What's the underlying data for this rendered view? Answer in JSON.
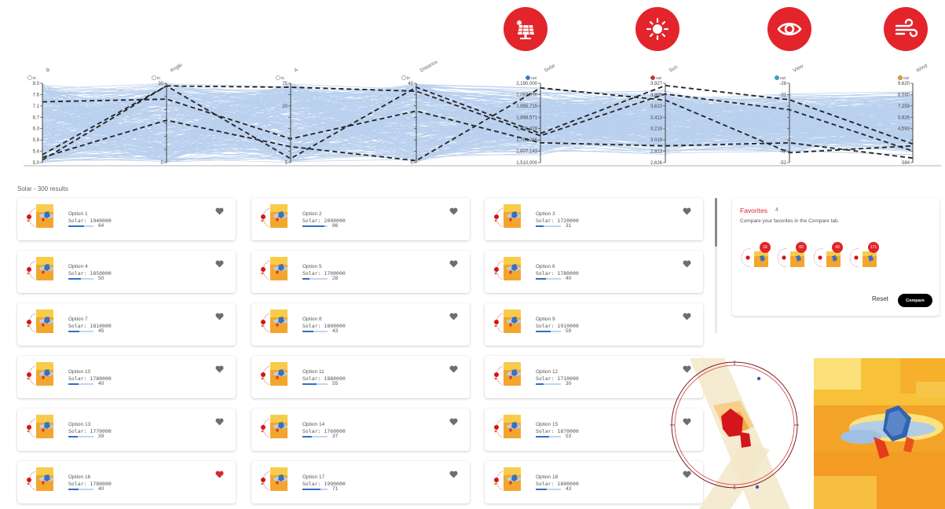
{
  "objectives": [
    {
      "name": "solar-icon",
      "color": "#e3242b"
    },
    {
      "name": "sun-icon",
      "color": "#e3242b"
    },
    {
      "name": "eye-icon",
      "color": "#e3242b"
    },
    {
      "name": "wind-icon",
      "color": "#e3242b"
    }
  ],
  "chart_data": {
    "type": "parallel-coordinates",
    "line_color": "#3a7ccf",
    "highlight_color": "#222222",
    "axes": [
      {
        "label": "B",
        "tag": "in",
        "tag_color": "#ffffff",
        "ticks": [
          "8.0",
          "7.6",
          "7.1",
          "6.7",
          "6.3",
          "5.9",
          "5.4",
          "5.0"
        ],
        "min": 5.0,
        "max": 8.0
      },
      {
        "label": "Angle",
        "tag": "in",
        "tag_color": "#ffffff",
        "ticks": [
          "30",
          "",
          "",
          "",
          "",
          "",
          "0"
        ],
        "min": 0,
        "max": 30
      },
      {
        "label": "A",
        "tag": "in",
        "tag_color": "#ffffff",
        "ticks": [
          "25",
          "",
          "20",
          "",
          "",
          "",
          "",
          "5"
        ],
        "min": 5,
        "max": 25
      },
      {
        "label": "Distance",
        "tag": "in",
        "tag_color": "#ffffff",
        "ticks": [
          "40",
          "",
          "",
          "",
          "",
          "",
          "",
          "0"
        ],
        "min": 0,
        "max": 40
      },
      {
        "label": "Solar",
        "tag": "out",
        "tag_color": "#3a7ccf",
        "ticks": [
          "2,190,000",
          "2,092,856",
          "1,995,715",
          "1,898,571",
          "1,801,429",
          "1,704,286",
          "1,607,143",
          "1,510,000"
        ],
        "min": 1510000,
        "max": 2190000
      },
      {
        "label": "Sun",
        "tag": "out",
        "tag_color": "#e3242b",
        "ticks": [
          "3,927",
          "3,809",
          "3,610",
          "3,413",
          "3,218",
          "3,019",
          "2,823",
          "2,626"
        ],
        "min": 2626,
        "max": 3927
      },
      {
        "label": "View",
        "tag": "out",
        "tag_color": "#1fa8e8",
        "ticks": [
          "-28",
          "-31",
          "",
          "",
          "",
          "",
          "-49",
          "-52"
        ],
        "min": -52,
        "max": -28
      },
      {
        "label": "Wind",
        "tag": "out",
        "tag_color": "#f29b1d",
        "ticks": [
          "9,620",
          "8,590",
          "7,259",
          "5,926",
          "4,593",
          "",
          "",
          "584"
        ],
        "min": 584,
        "max": 9620
      }
    ],
    "highlighted": [
      [
        5.1,
        29,
        6,
        38,
        1760000,
        3890,
        -33,
        2700
      ],
      [
        5.3,
        29,
        24,
        36,
        1740000,
        3750,
        -36,
        1900
      ],
      [
        7.3,
        24,
        11,
        26,
        1680000,
        2900,
        -46,
        1100
      ],
      [
        5.2,
        16,
        9,
        1,
        2150000,
        3650,
        -49,
        2500
      ]
    ]
  },
  "results": {
    "title": "Solar - 300 results",
    "solar_label": "Solar:",
    "items": [
      {
        "name": "Option 1",
        "solar": "1940000",
        "score": "64",
        "fav": false
      },
      {
        "name": "Option 2",
        "solar": "2090000",
        "score": "86",
        "fav": false
      },
      {
        "name": "Option 3",
        "solar": "1720000",
        "score": "31",
        "fav": false
      },
      {
        "name": "Option 4",
        "solar": "1850000",
        "score": "50",
        "fav": false
      },
      {
        "name": "Option 5",
        "solar": "1700000",
        "score": "28",
        "fav": false
      },
      {
        "name": "Option 6",
        "solar": "1780000",
        "score": "40",
        "fav": false
      },
      {
        "name": "Option 7",
        "solar": "1810000",
        "score": "45",
        "fav": false
      },
      {
        "name": "Option 8",
        "solar": "1800000",
        "score": "43",
        "fav": false
      },
      {
        "name": "Option 9",
        "solar": "1910000",
        "score": "59",
        "fav": false
      },
      {
        "name": "Option 10",
        "solar": "1780000",
        "score": "40",
        "fav": false
      },
      {
        "name": "Option 11",
        "solar": "1880000",
        "score": "55",
        "fav": false
      },
      {
        "name": "Option 12",
        "solar": "1710000",
        "score": "30",
        "fav": false
      },
      {
        "name": "Option 13",
        "solar": "1770000",
        "score": "39",
        "fav": false
      },
      {
        "name": "Option 14",
        "solar": "1760000",
        "score": "37",
        "fav": false
      },
      {
        "name": "Option 15",
        "solar": "1870000",
        "score": "53",
        "fav": false
      },
      {
        "name": "Option 16",
        "solar": "1780000",
        "score": "40",
        "fav": true
      },
      {
        "name": "Option 17",
        "solar": "1990000",
        "score": "71",
        "fav": false
      },
      {
        "name": "Option 18",
        "solar": "1800000",
        "score": "43",
        "fav": false
      }
    ]
  },
  "favorites": {
    "title": "Favorites",
    "count": "4",
    "description": "Compare your favorites in the Compare tab.",
    "badges": [
      "16",
      "60",
      "40",
      "171"
    ],
    "reset_label": "Reset",
    "compare_label": "Compare"
  }
}
